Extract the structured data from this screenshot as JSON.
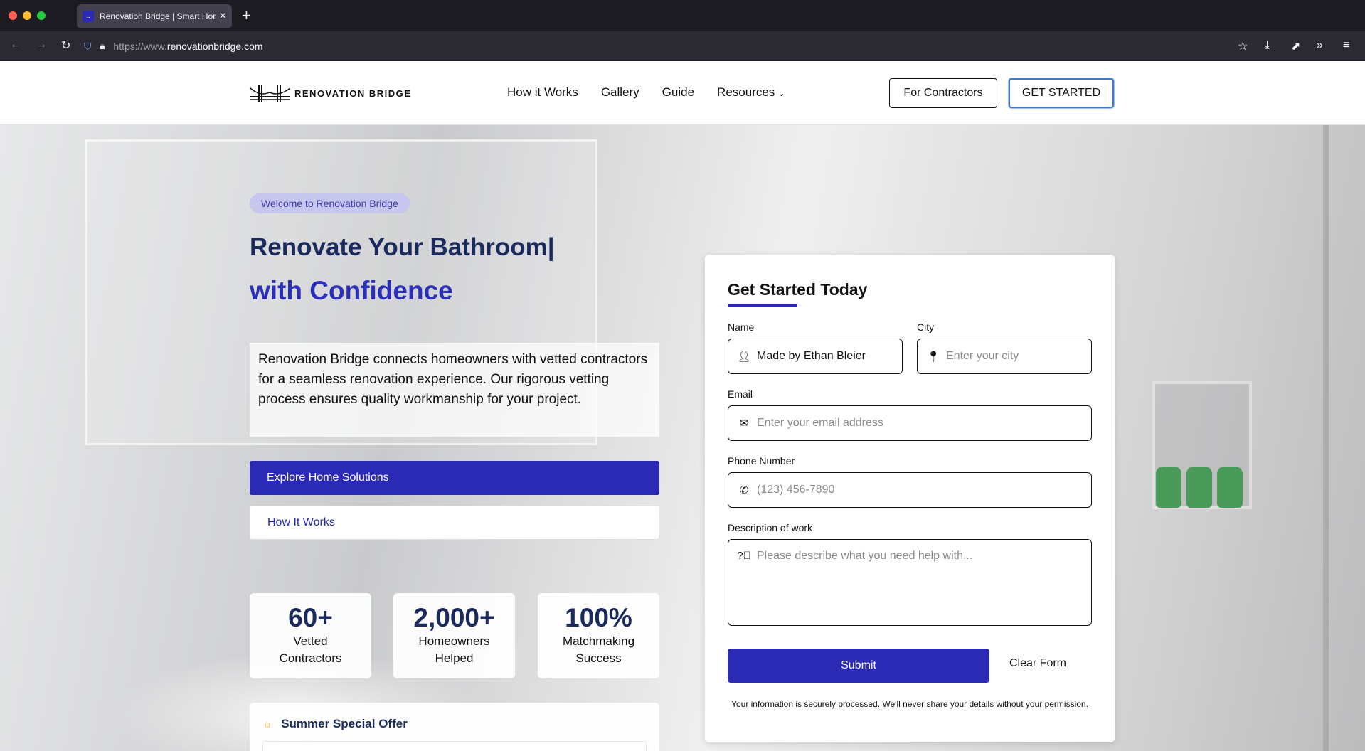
{
  "browser": {
    "tab_title": "Renovation Bridge | Smart Home Renovations",
    "url_prefix": "https://www.",
    "url_domain": "renovationbridge.com"
  },
  "header": {
    "logo_text": "RENOVATION BRIDGE",
    "menu": [
      "How it Works",
      "Gallery",
      "Guide",
      "Resources"
    ],
    "for_contractors": "For Contractors",
    "get_started": "GET STARTED"
  },
  "hero": {
    "badge": "Welcome to Renovation Bridge",
    "headline_line1": "Renovate Your Bathroom|",
    "headline_line2": "with Confidence",
    "intro": "Renovation Bridge connects homeowners with vetted contractors for a seamless renovation experience. Our rigorous vetting process ensures quality workmanship for your project.",
    "primary_cta": "Explore Home Solutions",
    "secondary_cta": "How It Works",
    "stats": [
      {
        "value": "60+",
        "label_line1": "Vetted",
        "label_line2": "Contractors"
      },
      {
        "value": "2,000+",
        "label_line1": "Homeowners",
        "label_line2": "Helped"
      },
      {
        "value": "100%",
        "label_line1": "Matchmaking",
        "label_line2": "Success"
      }
    ],
    "offer_title": "Summer Special Offer"
  },
  "form": {
    "title": "Get Started Today",
    "name_label": "Name",
    "name_value": "Made by Ethan Bleier",
    "city_label": "City",
    "city_placeholder": "Enter your city",
    "email_label": "Email",
    "email_placeholder": "Enter your email address",
    "phone_label": "Phone Number",
    "phone_placeholder": "(123) 456-7890",
    "description_label": "Description of work",
    "description_placeholder": "Please describe what you need help with...",
    "submit_label": "Submit",
    "clear_label": "Clear Form",
    "privacy_note": "Your information is securely processed. We'll never share your details without your permission."
  },
  "colors": {
    "brand_blue": "#2a2ab5",
    "navy": "#1b2a5c",
    "badge_bg": "#c7c6ee",
    "offer_icon": "#e8a317"
  },
  "icons": [
    "user-icon",
    "map-pin-icon",
    "envelope-icon",
    "phone-icon",
    "question-circle-icon",
    "sun-icon",
    "chevron-down-icon",
    "lock-icon",
    "shield-icon",
    "star-icon",
    "download-icon",
    "extensions-icon",
    "menu-icon"
  ]
}
